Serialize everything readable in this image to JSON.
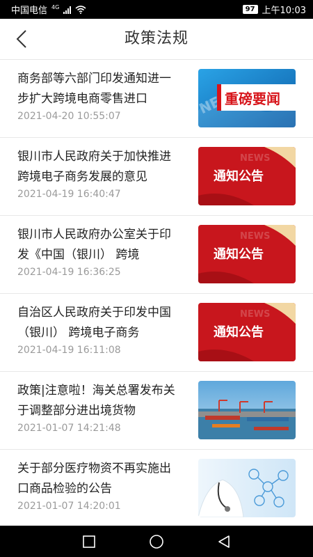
{
  "status_bar": {
    "carrier": "中国电信",
    "network": "4G",
    "battery": "97",
    "time": "上午10:03"
  },
  "header": {
    "title": "政策法规",
    "back_icon": "chevron-left-icon"
  },
  "news": [
    {
      "title": "商务部等六部门印发通知进一步扩大跨境电商零售进口",
      "date": "2021-04-20 10:55:07",
      "thumb_type": "blue-banner",
      "thumb_text": "重磅要闻"
    },
    {
      "title": "银川市人民政府关于加快推进跨境电子商务发展的意见",
      "date": "2021-04-19 16:40:47",
      "thumb_type": "red-notice",
      "thumb_text": "通知公告"
    },
    {
      "title": "银川市人民政府办公室关于印发《中国（银川） 跨境",
      "date": "2021-04-19 16:36:25",
      "thumb_type": "red-notice",
      "thumb_text": "通知公告"
    },
    {
      "title": "自治区人民政府关于印发中国（银川） 跨境电子商务",
      "date": "2021-04-19 16:11:08",
      "thumb_type": "red-notice",
      "thumb_text": "通知公告"
    },
    {
      "title": "政策|注意啦！海关总署发布关于调整部分进出境货物",
      "date": "2021-01-07 14:21:48",
      "thumb_type": "port-photo",
      "thumb_text": ""
    },
    {
      "title": "关于部分医疗物资不再实施出口商品检验的公告",
      "date": "2021-01-07 14:20:01",
      "thumb_type": "medical-photo",
      "thumb_text": ""
    }
  ],
  "nav_bar": {
    "recent_icon": "square-icon",
    "home_icon": "circle-icon",
    "back_icon": "triangle-back-icon"
  },
  "colors": {
    "notice_red": "#c8161d",
    "banner_blue": "#1e7fc4",
    "text_dark": "#222222",
    "text_gray": "#9a9a9a"
  }
}
